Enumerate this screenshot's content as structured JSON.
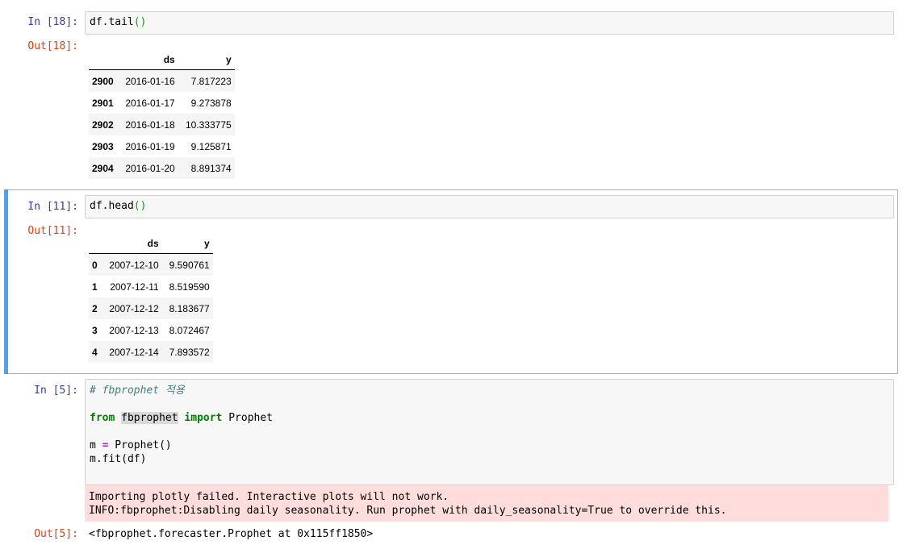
{
  "cells": [
    {
      "in_prompt": "In [18]:",
      "code": "df.tail",
      "code_parens": "()",
      "out_prompt": "Out[18]:",
      "table": {
        "columns": [
          "ds",
          "y"
        ],
        "rows": [
          {
            "index": "2900",
            "ds": "2016-01-16",
            "y": "7.817223"
          },
          {
            "index": "2901",
            "ds": "2016-01-17",
            "y": "9.273878"
          },
          {
            "index": "2902",
            "ds": "2016-01-18",
            "y": "10.333775"
          },
          {
            "index": "2903",
            "ds": "2016-01-19",
            "y": "9.125871"
          },
          {
            "index": "2904",
            "ds": "2016-01-20",
            "y": "8.891374"
          }
        ]
      }
    },
    {
      "in_prompt": "In [11]:",
      "code": "df.head",
      "code_parens": "()",
      "out_prompt": "Out[11]:",
      "table": {
        "columns": [
          "ds",
          "y"
        ],
        "rows": [
          {
            "index": "0",
            "ds": "2007-12-10",
            "y": "9.590761"
          },
          {
            "index": "1",
            "ds": "2007-12-11",
            "y": "8.519590"
          },
          {
            "index": "2",
            "ds": "2007-12-12",
            "y": "8.183677"
          },
          {
            "index": "3",
            "ds": "2007-12-13",
            "y": "8.072467"
          },
          {
            "index": "4",
            "ds": "2007-12-14",
            "y": "7.893572"
          }
        ]
      }
    },
    {
      "in_prompt": "In [5]:",
      "comment": "# fbprophet 적용",
      "line2_from": "from",
      "line2_module": "fbprophet",
      "line2_import": "import",
      "line2_name": " Prophet",
      "line3_var": "m ",
      "line3_op": "=",
      "line3_rest": " Prophet()",
      "line4": "m.fit(df)",
      "stderr": [
        "Importing plotly failed. Interactive plots will not work.",
        "INFO:fbprophet:Disabling daily seasonality. Run prophet with daily_seasonality=True to override this."
      ],
      "out_prompt": "Out[5]:",
      "out_text": "<fbprophet.forecaster.Prophet at 0x115ff1850>"
    }
  ]
}
